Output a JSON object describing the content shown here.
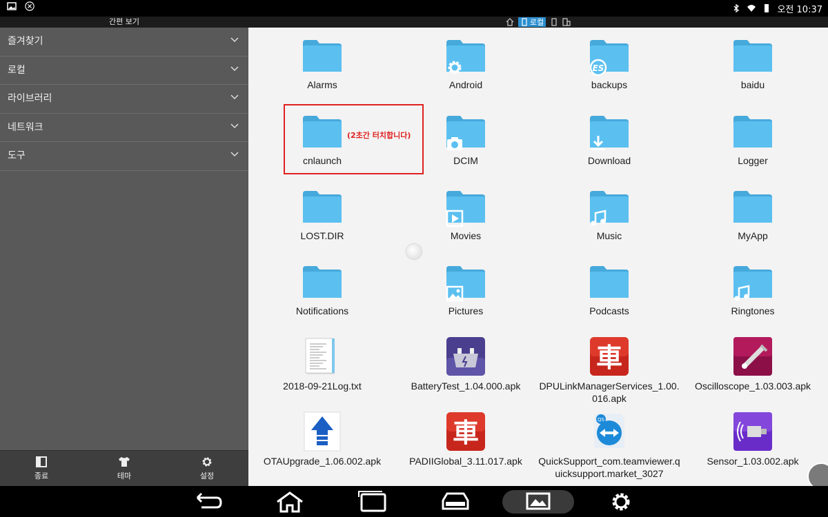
{
  "status": {
    "time_label": "오전 10:37"
  },
  "sidebar": {
    "title": "간편 보기",
    "items": [
      {
        "label": "즐겨찾기"
      },
      {
        "label": "로컬"
      },
      {
        "label": "라이브러리"
      },
      {
        "label": "네트워크"
      },
      {
        "label": "도구"
      }
    ],
    "bottom": [
      {
        "label": "종료",
        "icon": "exit-icon"
      },
      {
        "label": "테마",
        "icon": "shirt-icon"
      },
      {
        "label": "설정",
        "icon": "gear-icon"
      }
    ]
  },
  "topbar": {
    "active_tab": "로컬"
  },
  "files": [
    {
      "name": "Alarms",
      "type": "folder",
      "badge": ""
    },
    {
      "name": "Android",
      "type": "folder",
      "badge": "gear-icon"
    },
    {
      "name": "backups",
      "type": "folder",
      "badge": "es-icon"
    },
    {
      "name": "baidu",
      "type": "folder",
      "badge": ""
    },
    {
      "name": "cnlaunch",
      "type": "folder",
      "badge": ""
    },
    {
      "name": "DCIM",
      "type": "folder",
      "badge": "camera-icon"
    },
    {
      "name": "Download",
      "type": "folder",
      "badge": "download-icon"
    },
    {
      "name": "Logger",
      "type": "folder",
      "badge": ""
    },
    {
      "name": "LOST.DIR",
      "type": "folder",
      "badge": ""
    },
    {
      "name": "Movies",
      "type": "folder",
      "badge": "play-icon"
    },
    {
      "name": "Music",
      "type": "folder",
      "badge": "music-note-icon"
    },
    {
      "name": "MyApp",
      "type": "folder",
      "badge": ""
    },
    {
      "name": "Notifications",
      "type": "folder",
      "badge": ""
    },
    {
      "name": "Pictures",
      "type": "folder",
      "badge": "picture-icon"
    },
    {
      "name": "Podcasts",
      "type": "folder",
      "badge": ""
    },
    {
      "name": "Ringtones",
      "type": "folder",
      "badge": "music-note-icon"
    },
    {
      "name": "2018-09-21Log.txt",
      "type": "txt",
      "badge": ""
    },
    {
      "name": "BatteryTest_1.04.000.apk",
      "type": "apk-battery",
      "badge": ""
    },
    {
      "name": "DPULinkManagerServices_1.00.016.apk",
      "type": "apk-car",
      "badge": ""
    },
    {
      "name": "Oscilloscope_1.03.003.apk",
      "type": "apk-scope",
      "badge": ""
    },
    {
      "name": "OTAUpgrade_1.06.002.apk",
      "type": "apk-ota",
      "badge": ""
    },
    {
      "name": "PADIIGlobal_3.11.017.apk",
      "type": "apk-car",
      "badge": ""
    },
    {
      "name": "QuickSupport_com.teamviewer.quicksupport.market_3027",
      "type": "apk-teamviewer",
      "badge": ""
    },
    {
      "name": "Sensor_1.03.002.apk",
      "type": "apk-sensor",
      "badge": ""
    }
  ],
  "annotation": "(2초간 터치합니다)",
  "colors": {
    "folder": "#5bc0f0",
    "folder_dark": "#46a9dc",
    "highlight": "#e02020",
    "sidebar": "#595959"
  }
}
